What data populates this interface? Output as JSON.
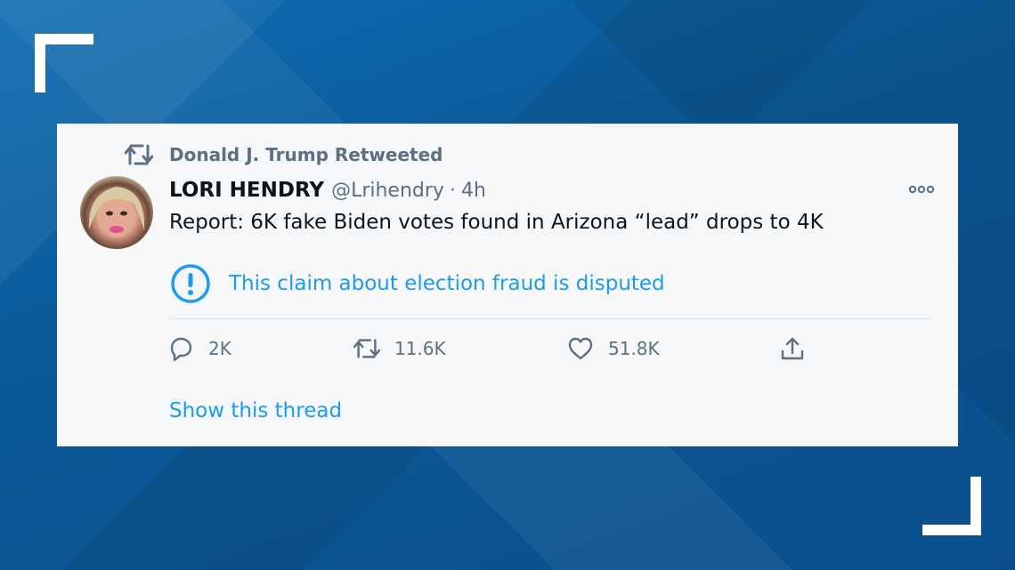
{
  "colors": {
    "link_blue": "#1d9bf0",
    "muted_gray": "#5b7083",
    "text_dark": "#0f1419",
    "card_bg": "#f6f7f8",
    "background_blue": "#0a5a9c"
  },
  "tweet": {
    "retweeted_by": "Donald J. Trump Retweeted",
    "author_name": "LORI HENDRY",
    "author_handle": "@Lrihendry",
    "separator": "·",
    "time": "4h",
    "text": "Report: 6K fake Biden votes found in Arizona “lead” drops to 4K",
    "notice": "This claim about election fraud is disputed",
    "actions": {
      "replies": "2K",
      "retweets": "11.6K",
      "likes": "51.8K"
    },
    "show_thread": "Show this thread"
  },
  "icons": {
    "retweet_header": "retweet-icon",
    "more": "more-options-icon",
    "notice": "exclamation-circle-icon",
    "reply": "reply-icon",
    "retweet": "retweet-icon",
    "like": "heart-icon",
    "share": "share-icon"
  }
}
